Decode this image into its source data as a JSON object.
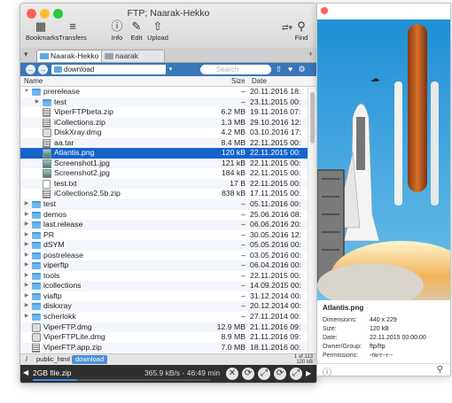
{
  "window": {
    "title": "FTP; Naarak-Hekko"
  },
  "toolbar": [
    {
      "label": "Bookmarks",
      "icon": "bookmarks-icon"
    },
    {
      "label": "Transfers",
      "icon": "transfers-icon"
    },
    {
      "label": "Info",
      "icon": "info-icon"
    },
    {
      "label": "Edit",
      "icon": "edit-icon"
    },
    {
      "label": "Upload",
      "icon": "upload-icon"
    },
    {
      "label": "Find",
      "icon": "find-icon"
    }
  ],
  "tabs": [
    "Naarak-Hekko",
    "naarak"
  ],
  "pathbar": {
    "folder": "download",
    "search_placeholder": "Search"
  },
  "columns": {
    "name": "Name",
    "size": "Size",
    "date": "Date"
  },
  "rows": [
    {
      "name": "prerelease",
      "size": "–",
      "date": "20.11.2016 18:",
      "type": "folder",
      "level": 0,
      "expanded": true
    },
    {
      "name": "test",
      "size": "–",
      "date": "23.11.2015 00:",
      "type": "folder",
      "level": 1,
      "expanded": false
    },
    {
      "name": "ViperFTPbeta.zip",
      "size": "6.2 MB",
      "date": "19.11.2016 07:",
      "type": "zip",
      "level": 1
    },
    {
      "name": "iCollections.zip",
      "size": "1.3 MB",
      "date": "29.10.2016 12:",
      "type": "zip",
      "level": 1
    },
    {
      "name": "DiskXray.dmg",
      "size": "4.2 MB",
      "date": "03.10.2016 17:",
      "type": "dmg",
      "level": 1
    },
    {
      "name": "aa.tar",
      "size": "8.4 MB",
      "date": "22.11.2015 00:",
      "type": "zip",
      "level": 1
    },
    {
      "name": "Atlantis.png",
      "size": "120 kB",
      "date": "22.11.2015 00:",
      "type": "img",
      "level": 1,
      "selected": true
    },
    {
      "name": "Screenshot1.jpg",
      "size": "121 kB",
      "date": "22.11.2015 00:",
      "type": "img",
      "level": 1
    },
    {
      "name": "Screenshot2.jpg",
      "size": "184 kB",
      "date": "22.11.2015 00:",
      "type": "img",
      "level": 1
    },
    {
      "name": "test.txt",
      "size": "17 B",
      "date": "22.11.2015 00:",
      "type": "file",
      "level": 1
    },
    {
      "name": "iCollections2.5b.zip",
      "size": "838 kB",
      "date": "17.11.2015 00:",
      "type": "zip",
      "level": 1
    },
    {
      "name": "test",
      "size": "–",
      "date": "05.11.2016 00:",
      "type": "folder",
      "level": 0,
      "expanded": false
    },
    {
      "name": "demos",
      "size": "–",
      "date": "25.06.2016 08:",
      "type": "folder",
      "level": 0,
      "expanded": false
    },
    {
      "name": "last.release",
      "size": "–",
      "date": "06.06.2016 20:",
      "type": "folder",
      "level": 0,
      "expanded": false
    },
    {
      "name": "PR",
      "size": "–",
      "date": "30.05.2016 12:",
      "type": "folder",
      "level": 0,
      "expanded": false
    },
    {
      "name": "dSYM",
      "size": "–",
      "date": "05.05.2016 00:",
      "type": "folder",
      "level": 0,
      "expanded": false
    },
    {
      "name": "postrelease",
      "size": "–",
      "date": "03.05.2016 00:",
      "type": "folder",
      "level": 0,
      "expanded": false
    },
    {
      "name": "viperftp",
      "size": "–",
      "date": "06.04.2016 00:",
      "type": "folder",
      "level": 0,
      "expanded": false
    },
    {
      "name": "tools",
      "size": "–",
      "date": "22.11.2015 00:",
      "type": "folder",
      "level": 0,
      "expanded": false
    },
    {
      "name": "icollections",
      "size": "–",
      "date": "14.09.2015 00:",
      "type": "folder",
      "level": 0,
      "expanded": false
    },
    {
      "name": "viaftp",
      "size": "–",
      "date": "31.12.2014 00:",
      "type": "folder",
      "level": 0,
      "expanded": false
    },
    {
      "name": "diskxray",
      "size": "–",
      "date": "20.12.2014 00:",
      "type": "folder",
      "level": 0,
      "expanded": false
    },
    {
      "name": "scherlokk",
      "size": "–",
      "date": "27.11.2014 00:",
      "type": "folder",
      "level": 0,
      "expanded": false
    },
    {
      "name": "ViperFTP.dmg",
      "size": "12.9 MB",
      "date": "21.11.2016 09:",
      "type": "dmg",
      "level": 0
    },
    {
      "name": "ViperFTPLite.dmg",
      "size": "8.9 MB",
      "date": "21.11.2016 09:",
      "type": "dmg",
      "level": 0
    },
    {
      "name": "ViperFTP.app.zip",
      "size": "7.0 MB",
      "date": "18.11.2016 00:",
      "type": "zip",
      "level": 0
    }
  ],
  "breadcrumb": [
    "/",
    "public_html",
    "download"
  ],
  "count": {
    "line1": "1 of 113",
    "line2": "120 kB"
  },
  "transfer": {
    "file": "2GB file.zip",
    "rate": "365.9 kB/s - 46:49 min",
    "progress": 0.25
  },
  "info": {
    "title": "Atlantis.png",
    "fields": [
      {
        "k": "Dimensions:",
        "v": "440 x 229"
      },
      {
        "k": "Size:",
        "v": "120 kB"
      },
      {
        "k": "Date:",
        "v": "22.11.2015 00:00:00"
      },
      {
        "k": "Owner/Group:",
        "v": "ftp/ftp"
      },
      {
        "k": "Permissions:",
        "v": "-rw-r--r--"
      }
    ]
  },
  "colors": {
    "selection": "#1563c9",
    "pathbar": "#3a76b9",
    "transfer_bg": "#2f2f2f",
    "progress": "#3d8ee6"
  }
}
